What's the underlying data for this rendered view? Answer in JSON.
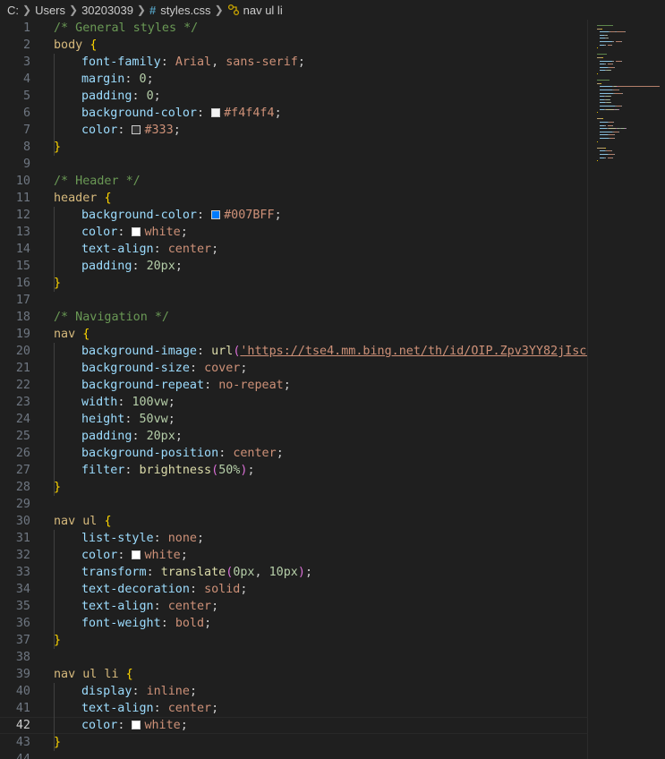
{
  "breadcrumb": {
    "items": [
      "C:",
      "Users",
      "30203039",
      "styles.css",
      "nav ul li"
    ]
  },
  "colors": {
    "background": "#1f1f1f",
    "comment": "#6a9955",
    "selector": "#d7ba7d",
    "property": "#9cdcfe",
    "value": "#ce9178",
    "number": "#b5cea8",
    "function": "#dcdcaa",
    "brace": "#ffd700",
    "paren": "#da70d6"
  },
  "editor": {
    "current_line": 42,
    "lines": [
      {
        "n": "1",
        "tokens": [
          [
            "comment",
            "/* General styles */"
          ]
        ]
      },
      {
        "n": "2",
        "tokens": [
          [
            "selector",
            "body "
          ],
          [
            "brace",
            "{"
          ]
        ]
      },
      {
        "n": "3",
        "indent": 1,
        "tokens": [
          [
            "prop",
            "font-family"
          ],
          [
            "punct",
            ": "
          ],
          [
            "value",
            "Arial"
          ],
          [
            "punct",
            ", "
          ],
          [
            "value",
            "sans-serif"
          ],
          [
            "punct",
            ";"
          ]
        ]
      },
      {
        "n": "4",
        "indent": 1,
        "tokens": [
          [
            "prop",
            "margin"
          ],
          [
            "punct",
            ": "
          ],
          [
            "num",
            "0"
          ],
          [
            "punct",
            ";"
          ]
        ]
      },
      {
        "n": "5",
        "indent": 1,
        "tokens": [
          [
            "prop",
            "padding"
          ],
          [
            "punct",
            ": "
          ],
          [
            "num",
            "0"
          ],
          [
            "punct",
            ";"
          ]
        ]
      },
      {
        "n": "6",
        "indent": 1,
        "tokens": [
          [
            "prop",
            "background-color"
          ],
          [
            "punct",
            ": "
          ],
          [
            "swatch",
            "#f4f4f4"
          ],
          [
            "value",
            "#f4f4f4"
          ],
          [
            "punct",
            ";"
          ]
        ]
      },
      {
        "n": "7",
        "indent": 1,
        "tokens": [
          [
            "prop",
            "color"
          ],
          [
            "punct",
            ": "
          ],
          [
            "swatch",
            "#333333"
          ],
          [
            "value",
            "#333"
          ],
          [
            "punct",
            ";"
          ]
        ]
      },
      {
        "n": "8",
        "tokens": [
          [
            "brace",
            "}"
          ]
        ]
      },
      {
        "n": "9",
        "tokens": []
      },
      {
        "n": "10",
        "tokens": [
          [
            "comment",
            "/* Header */"
          ]
        ]
      },
      {
        "n": "11",
        "tokens": [
          [
            "selector",
            "header "
          ],
          [
            "brace",
            "{"
          ]
        ]
      },
      {
        "n": "12",
        "indent": 1,
        "tokens": [
          [
            "prop",
            "background-color"
          ],
          [
            "punct",
            ": "
          ],
          [
            "swatch",
            "#007BFF"
          ],
          [
            "value",
            "#007BFF"
          ],
          [
            "punct",
            ";"
          ]
        ]
      },
      {
        "n": "13",
        "indent": 1,
        "tokens": [
          [
            "prop",
            "color"
          ],
          [
            "punct",
            ": "
          ],
          [
            "swatch",
            "#ffffff"
          ],
          [
            "value",
            "white"
          ],
          [
            "punct",
            ";"
          ]
        ]
      },
      {
        "n": "14",
        "indent": 1,
        "tokens": [
          [
            "prop",
            "text-align"
          ],
          [
            "punct",
            ": "
          ],
          [
            "value",
            "center"
          ],
          [
            "punct",
            ";"
          ]
        ]
      },
      {
        "n": "15",
        "indent": 1,
        "tokens": [
          [
            "prop",
            "padding"
          ],
          [
            "punct",
            ": "
          ],
          [
            "num",
            "20px"
          ],
          [
            "punct",
            ";"
          ]
        ]
      },
      {
        "n": "16",
        "tokens": [
          [
            "brace",
            "}"
          ]
        ]
      },
      {
        "n": "17",
        "tokens": []
      },
      {
        "n": "18",
        "tokens": [
          [
            "comment",
            "/* Navigation */"
          ]
        ]
      },
      {
        "n": "19",
        "tokens": [
          [
            "selector",
            "nav "
          ],
          [
            "brace",
            "{"
          ]
        ]
      },
      {
        "n": "20",
        "indent": 1,
        "tokens": [
          [
            "prop",
            "background-image"
          ],
          [
            "punct",
            ": "
          ],
          [
            "func",
            "url"
          ],
          [
            "paren",
            "("
          ],
          [
            "url",
            "'https://tse4.mm.bing.net/th/id/OIP.Zpv3YY82jIscDMmu"
          ]
        ]
      },
      {
        "n": "21",
        "indent": 1,
        "tokens": [
          [
            "prop",
            "background-size"
          ],
          [
            "punct",
            ": "
          ],
          [
            "value",
            "cover"
          ],
          [
            "punct",
            ";"
          ]
        ]
      },
      {
        "n": "22",
        "indent": 1,
        "tokens": [
          [
            "prop",
            "background-repeat"
          ],
          [
            "punct",
            ": "
          ],
          [
            "value",
            "no-repeat"
          ],
          [
            "punct",
            ";"
          ]
        ]
      },
      {
        "n": "23",
        "indent": 1,
        "tokens": [
          [
            "prop",
            "width"
          ],
          [
            "punct",
            ": "
          ],
          [
            "num",
            "100vw"
          ],
          [
            "punct",
            ";"
          ]
        ]
      },
      {
        "n": "24",
        "indent": 1,
        "tokens": [
          [
            "prop",
            "height"
          ],
          [
            "punct",
            ": "
          ],
          [
            "num",
            "50vw"
          ],
          [
            "punct",
            ";"
          ]
        ]
      },
      {
        "n": "25",
        "indent": 1,
        "tokens": [
          [
            "prop",
            "padding"
          ],
          [
            "punct",
            ": "
          ],
          [
            "num",
            "20px"
          ],
          [
            "punct",
            ";"
          ]
        ]
      },
      {
        "n": "26",
        "indent": 1,
        "tokens": [
          [
            "prop",
            "background-position"
          ],
          [
            "punct",
            ": "
          ],
          [
            "value",
            "center"
          ],
          [
            "punct",
            ";"
          ]
        ]
      },
      {
        "n": "27",
        "indent": 1,
        "tokens": [
          [
            "prop",
            "filter"
          ],
          [
            "punct",
            ": "
          ],
          [
            "func",
            "brightness"
          ],
          [
            "paren",
            "("
          ],
          [
            "num",
            "50%"
          ],
          [
            "paren",
            ")"
          ],
          [
            "punct",
            ";"
          ]
        ]
      },
      {
        "n": "28",
        "tokens": [
          [
            "brace",
            "}"
          ]
        ]
      },
      {
        "n": "29",
        "tokens": []
      },
      {
        "n": "30",
        "tokens": [
          [
            "selector",
            "nav ul "
          ],
          [
            "brace",
            "{"
          ]
        ]
      },
      {
        "n": "31",
        "indent": 1,
        "tokens": [
          [
            "prop",
            "list-style"
          ],
          [
            "punct",
            ": "
          ],
          [
            "value",
            "none"
          ],
          [
            "punct",
            ";"
          ]
        ]
      },
      {
        "n": "32",
        "indent": 1,
        "tokens": [
          [
            "prop",
            "color"
          ],
          [
            "punct",
            ": "
          ],
          [
            "swatch",
            "#ffffff"
          ],
          [
            "value",
            "white"
          ],
          [
            "punct",
            ";"
          ]
        ]
      },
      {
        "n": "33",
        "indent": 1,
        "tokens": [
          [
            "prop",
            "transform"
          ],
          [
            "punct",
            ": "
          ],
          [
            "func",
            "translate"
          ],
          [
            "paren",
            "("
          ],
          [
            "num",
            "0px"
          ],
          [
            "punct",
            ", "
          ],
          [
            "num",
            "10px"
          ],
          [
            "paren",
            ")"
          ],
          [
            "punct",
            ";"
          ]
        ]
      },
      {
        "n": "34",
        "indent": 1,
        "tokens": [
          [
            "prop",
            "text-decoration"
          ],
          [
            "punct",
            ": "
          ],
          [
            "value",
            "solid"
          ],
          [
            "punct",
            ";"
          ]
        ]
      },
      {
        "n": "35",
        "indent": 1,
        "tokens": [
          [
            "prop",
            "text-align"
          ],
          [
            "punct",
            ": "
          ],
          [
            "value",
            "center"
          ],
          [
            "punct",
            ";"
          ]
        ]
      },
      {
        "n": "36",
        "indent": 1,
        "tokens": [
          [
            "prop",
            "font-weight"
          ],
          [
            "punct",
            ": "
          ],
          [
            "value",
            "bold"
          ],
          [
            "punct",
            ";"
          ]
        ]
      },
      {
        "n": "37",
        "tokens": [
          [
            "brace",
            "}"
          ]
        ]
      },
      {
        "n": "38",
        "tokens": []
      },
      {
        "n": "39",
        "tokens": [
          [
            "selector",
            "nav ul li "
          ],
          [
            "brace",
            "{"
          ]
        ]
      },
      {
        "n": "40",
        "indent": 1,
        "tokens": [
          [
            "prop",
            "display"
          ],
          [
            "punct",
            ": "
          ],
          [
            "value",
            "inline"
          ],
          [
            "punct",
            ";"
          ]
        ]
      },
      {
        "n": "41",
        "indent": 1,
        "tokens": [
          [
            "prop",
            "text-align"
          ],
          [
            "punct",
            ": "
          ],
          [
            "value",
            "center"
          ],
          [
            "punct",
            ";"
          ]
        ]
      },
      {
        "n": "42",
        "indent": 1,
        "tokens": [
          [
            "prop",
            "color"
          ],
          [
            "punct",
            ": "
          ],
          [
            "swatch",
            "#ffffff"
          ],
          [
            "value",
            "white"
          ],
          [
            "punct",
            ";"
          ]
        ]
      },
      {
        "n": "43",
        "tokens": [
          [
            "brace",
            "}"
          ]
        ]
      },
      {
        "n": "44",
        "tokens": []
      }
    ]
  }
}
